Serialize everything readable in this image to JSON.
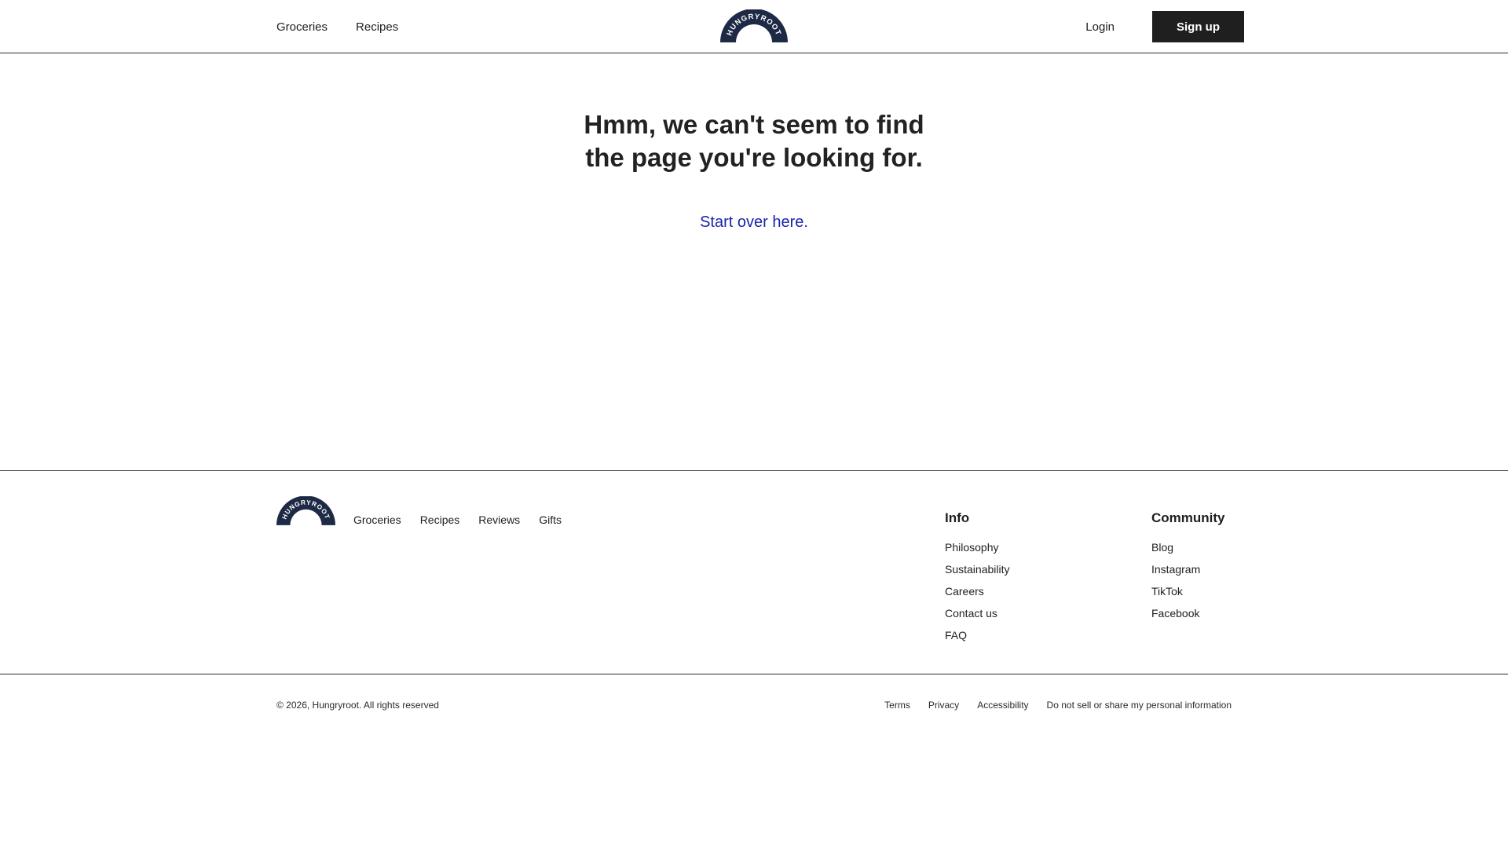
{
  "header": {
    "nav": [
      {
        "label": "Groceries"
      },
      {
        "label": "Recipes"
      }
    ],
    "logo_text": "HUNGRYROOT",
    "login_label": "Login",
    "signup_label": "Sign up"
  },
  "main": {
    "headline_line1": "Hmm, we can't seem to find",
    "headline_line2": "the page you're looking for.",
    "link_label": "Start over here."
  },
  "footer": {
    "logo_text": "HUNGRYROOT",
    "nav": [
      {
        "label": "Groceries"
      },
      {
        "label": "Recipes"
      },
      {
        "label": "Reviews"
      },
      {
        "label": "Gifts"
      }
    ],
    "info": {
      "title": "Info",
      "links": [
        "Philosophy",
        "Sustainability",
        "Careers",
        "Contact us",
        "FAQ"
      ]
    },
    "community": {
      "title": "Community",
      "links": [
        "Blog",
        "Instagram",
        "TikTok",
        "Facebook"
      ]
    }
  },
  "bottom": {
    "copyright": "© 2026, Hungryroot. All rights reserved",
    "links": [
      "Terms",
      "Privacy",
      "Accessibility",
      "Do not sell or share my personal information"
    ]
  },
  "colors": {
    "logo": "#1e2a45",
    "link_blue": "#1c24a8",
    "button_bg": "#1f1f1f"
  }
}
